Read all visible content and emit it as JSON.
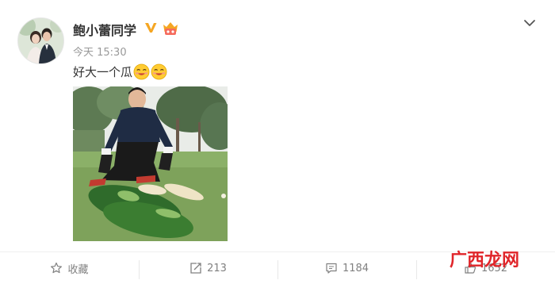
{
  "post": {
    "username": "鲍小蕾同学",
    "timestamp": "今天 15:30",
    "text": "好大一个瓜",
    "emojis": [
      "drooling-emoji",
      "drooling-emoji"
    ],
    "photo": "man-kneeling-by-giant-wax-gourds"
  },
  "icons": {
    "verified": "verified-v-icon",
    "member": "member-crown-badge-icon",
    "menu": "chevron-down-icon"
  },
  "actions": {
    "favorite_label": "收藏",
    "repost_count": "213",
    "comment_count": "1184",
    "like_count": "1652"
  },
  "watermark": {
    "text": "广西龙网"
  },
  "colors": {
    "verified": "#f5a623",
    "watermark": "#e0252a",
    "muted": "#808080"
  }
}
